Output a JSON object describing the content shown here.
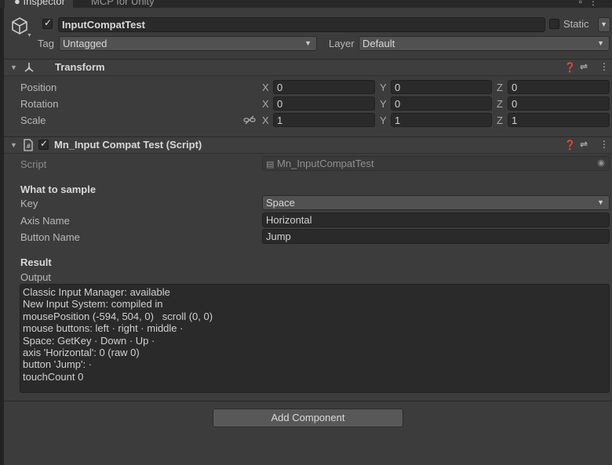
{
  "tabs": [
    {
      "label": "Inspector",
      "icon": "info-icon",
      "active": true
    },
    {
      "label": "MCP for Unity",
      "active": false
    }
  ],
  "header": {
    "enabled": true,
    "object_name": "InputCompatTest",
    "static_label": "Static",
    "tag_label": "Tag",
    "tag_value": "Untagged",
    "layer_label": "Layer",
    "layer_value": "Default"
  },
  "transform": {
    "title": "Transform",
    "rows": [
      {
        "label": "Position",
        "x": "0",
        "y": "0",
        "z": "0"
      },
      {
        "label": "Rotation",
        "x": "0",
        "y": "0",
        "z": "0"
      },
      {
        "label": "Scale",
        "x": "1",
        "y": "1",
        "z": "1"
      }
    ],
    "axis_labels": {
      "x": "X",
      "y": "Y",
      "z": "Z"
    }
  },
  "script_component": {
    "title": "Mn_Input Compat Test (Script)",
    "enabled": true,
    "script_label": "Script",
    "script_value": "Mn_InputCompatTest",
    "section_sample": "What to sample",
    "key_label": "Key",
    "key_value": "Space",
    "axis_name_label": "Axis Name",
    "axis_name_value": "Horizontal",
    "button_name_label": "Button Name",
    "button_name_value": "Jump",
    "section_result": "Result",
    "output_label": "Output",
    "output_lines": [
      "Classic Input Manager: available",
      "New Input System: compiled in",
      "mousePosition (-594, 504, 0)   scroll (0, 0)",
      "mouse buttons: left · right · middle ·",
      "Space: GetKey · Down · Up ·",
      "axis 'Horizontal': 0 (raw 0)",
      "button 'Jump': ·",
      "touchCount 0"
    ]
  },
  "add_component_label": "Add Component",
  "colors": {
    "panel_bg": "#3c3c3c",
    "field_bg": "#2a2a2a",
    "button_bg": "#585858"
  }
}
